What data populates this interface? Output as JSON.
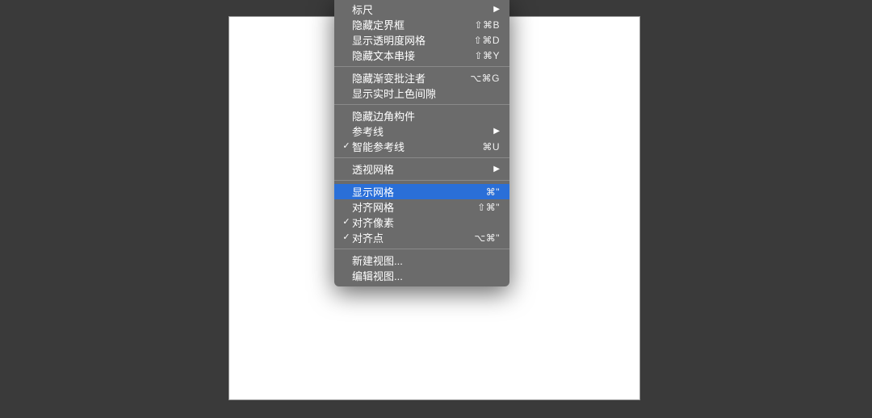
{
  "menu": {
    "groups": [
      [
        {
          "id": "rulers",
          "label": "标尺",
          "shortcut": "",
          "submenu": true,
          "checked": false
        },
        {
          "id": "hide-bounding-box",
          "label": "隐藏定界框",
          "shortcut": "⇧⌘B",
          "submenu": false,
          "checked": false
        },
        {
          "id": "show-transparency-grid",
          "label": "显示透明度网格",
          "shortcut": "⇧⌘D",
          "submenu": false,
          "checked": false
        },
        {
          "id": "hide-text-threads",
          "label": "隐藏文本串接",
          "shortcut": "⇧⌘Y",
          "submenu": false,
          "checked": false
        }
      ],
      [
        {
          "id": "hide-gradient-annotator",
          "label": "隐藏渐变批注者",
          "shortcut": "⌥⌘G",
          "submenu": false,
          "checked": false
        },
        {
          "id": "show-live-paint-gaps",
          "label": "显示实时上色间隙",
          "shortcut": "",
          "submenu": false,
          "checked": false
        }
      ],
      [
        {
          "id": "hide-corner-widget",
          "label": "隐藏边角构件",
          "shortcut": "",
          "submenu": false,
          "checked": false
        },
        {
          "id": "guides",
          "label": "参考线",
          "shortcut": "",
          "submenu": true,
          "checked": false
        },
        {
          "id": "smart-guides",
          "label": "智能参考线",
          "shortcut": "⌘U",
          "submenu": false,
          "checked": true
        }
      ],
      [
        {
          "id": "perspective-grid",
          "label": "透视网格",
          "shortcut": "",
          "submenu": true,
          "checked": false
        }
      ],
      [
        {
          "id": "show-grid",
          "label": "显示网格",
          "shortcut": "⌘\"",
          "submenu": false,
          "checked": false,
          "highlighted": true
        },
        {
          "id": "snap-to-grid",
          "label": "对齐网格",
          "shortcut": "⇧⌘\"",
          "submenu": false,
          "checked": false
        },
        {
          "id": "snap-to-pixel",
          "label": "对齐像素",
          "shortcut": "",
          "submenu": false,
          "checked": true
        },
        {
          "id": "snap-to-point",
          "label": "对齐点",
          "shortcut": "⌥⌘\"",
          "submenu": false,
          "checked": true
        }
      ],
      [
        {
          "id": "new-view",
          "label": "新建视图...",
          "shortcut": "",
          "submenu": false,
          "checked": false
        },
        {
          "id": "edit-views",
          "label": "编辑视图...",
          "shortcut": "",
          "submenu": false,
          "checked": false
        }
      ]
    ]
  }
}
